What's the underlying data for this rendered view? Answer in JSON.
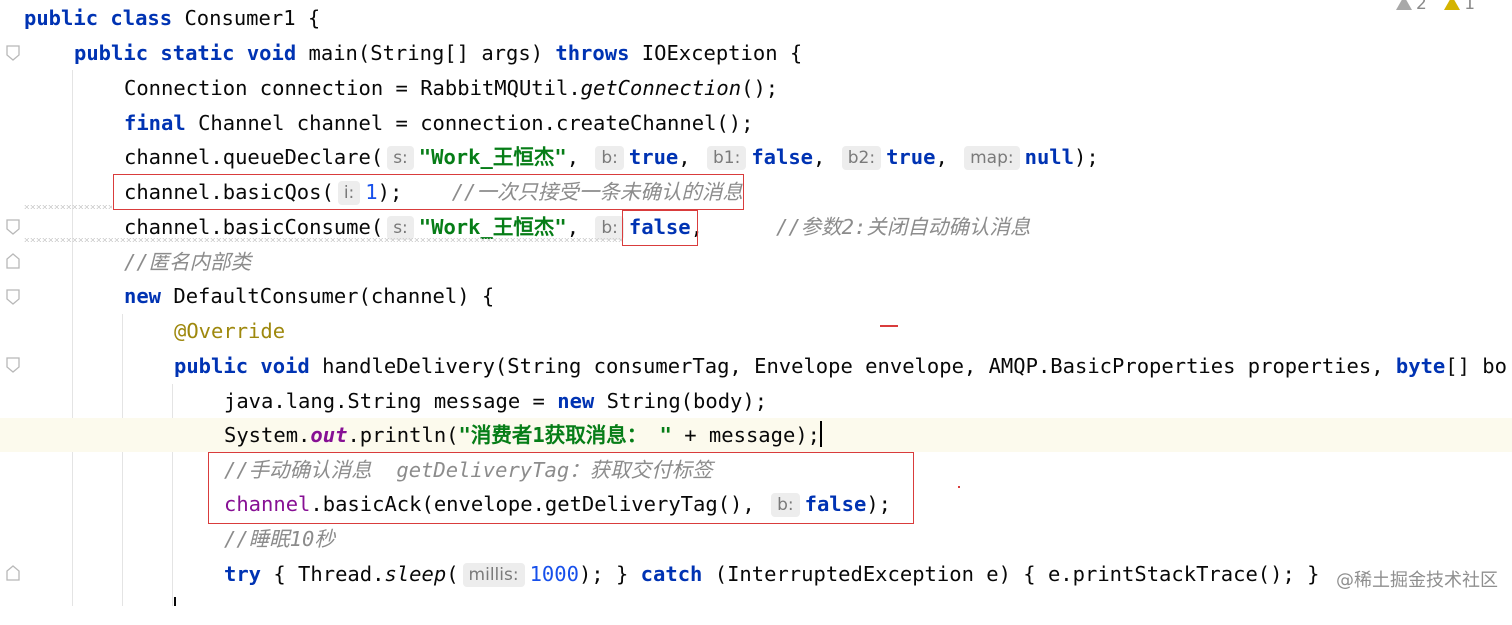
{
  "inspections": {
    "warnings": "2",
    "weak_warnings": "1",
    "warn_color": "#a8a8a8",
    "weak_color": "#d4b300"
  },
  "code": {
    "l1": [
      "public",
      "class",
      "Consumer1 {"
    ],
    "l2": [
      "public",
      "static",
      "void",
      "main(String[] args)",
      "throws",
      "IOException {"
    ],
    "l3": [
      "Connection connection = RabbitMQUtil.",
      "getConnection",
      "();"
    ],
    "l4": [
      "final",
      "Channel channel = connection.createChannel();"
    ],
    "l5": [
      "channel.queueDeclare(",
      "s:",
      "\"Work_王恒杰\"",
      ",",
      "b:",
      "true",
      ",",
      "b1:",
      "false",
      ",",
      "b2:",
      "true",
      ",",
      "map:",
      "null",
      ");"
    ],
    "l6": [
      "channel.basicQos(",
      "i:",
      "1",
      ");",
      "//一次只接受一条未确认的消息"
    ],
    "l7": [
      "channel.basicConsume(",
      "s:",
      "\"Work_王恒杰\"",
      ",",
      "b:",
      "false",
      ",",
      "//参数2:关闭自动确认消息"
    ],
    "l8": [
      "//匿名内部类"
    ],
    "l9": [
      "new",
      "DefaultConsumer(channel) {"
    ],
    "l10": [
      "@Override"
    ],
    "l11": [
      "public",
      "void",
      "handleDelivery(String consumerTag, Envelope envelope, AMQP.BasicProperties properties,",
      "byte",
      "[] bo"
    ],
    "l12": [
      "java.lang.String message =",
      "new",
      "String(body);"
    ],
    "l13": [
      "System.",
      "out",
      ".println(",
      "\"消费者1获取消息： \"",
      " + message);"
    ],
    "l14": [
      "//手动确认消息  getDeliveryTag：获取交付标签"
    ],
    "l15": [
      "channel",
      ".basicAck(envelope.getDeliveryTag(),",
      "b:",
      "false",
      ");"
    ],
    "l16": [
      "//睡眠10秒"
    ],
    "l17": [
      "try",
      "{ Thread.",
      "sleep",
      "(",
      "millis:",
      "1000",
      "); }",
      "catch",
      "(InterruptedException e) { e.printStackTrace(); }"
    ]
  },
  "watermark": "@稀土掘金技术社区",
  "colors": {
    "highlight_box": "#d93c3c",
    "keyword": "#0033b3",
    "string": "#067d17",
    "comment": "#8c8c8c"
  }
}
